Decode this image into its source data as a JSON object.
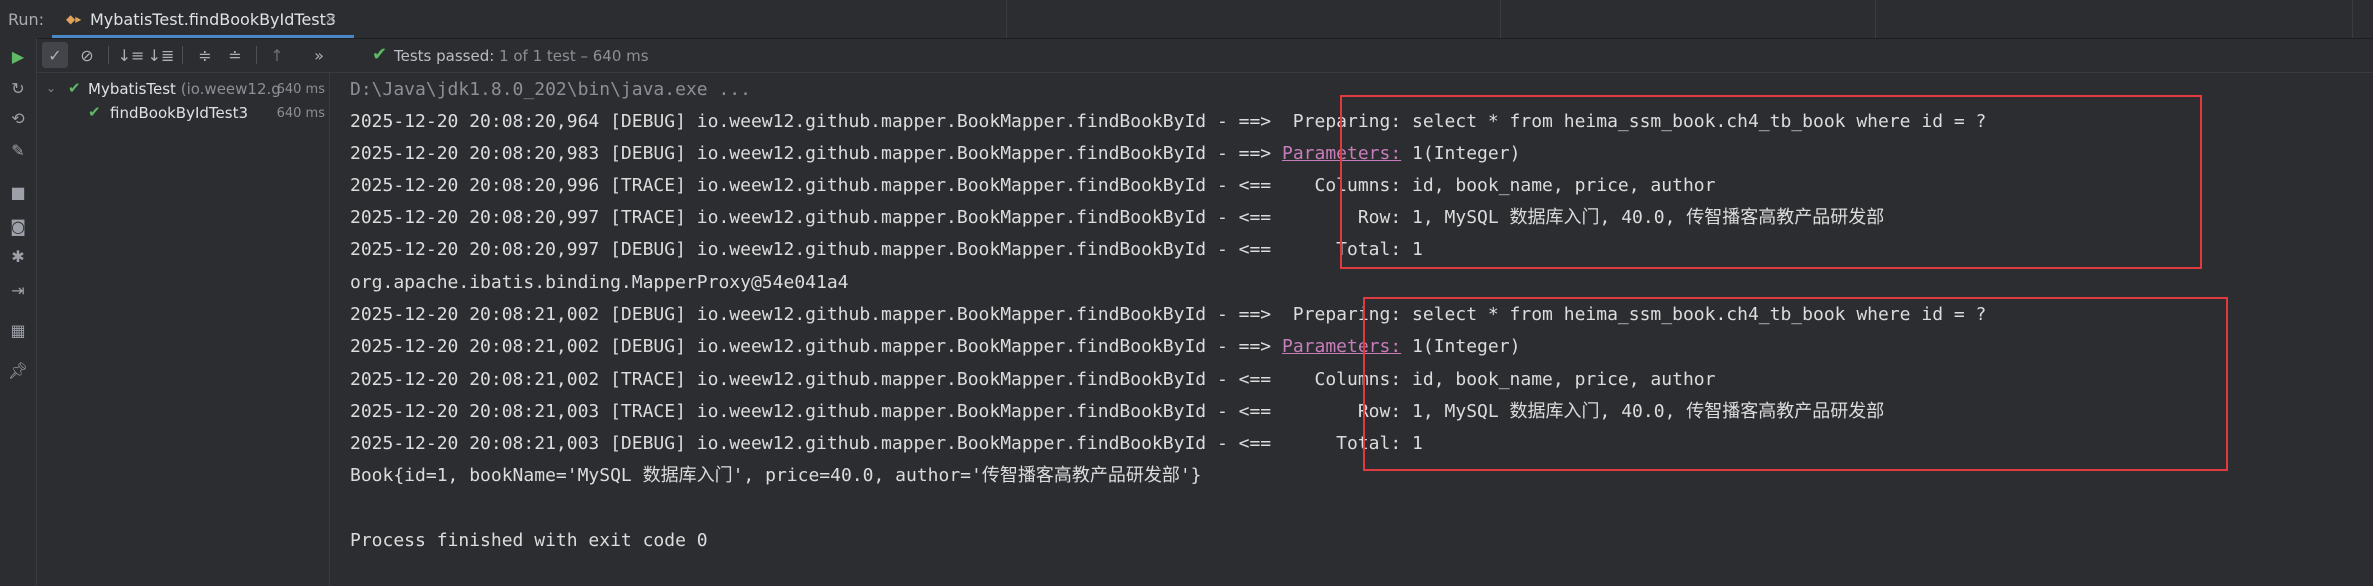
{
  "header": {
    "run_label": "Run:",
    "tab_title": "MybatisTest.findBookByIdTest3",
    "tab_close": "×"
  },
  "toolbar": {
    "status_passed": "Tests passed:",
    "status_count": "1 of 1 test – 640 ms"
  },
  "tree": {
    "root_label": "MybatisTest",
    "root_pkg": "(io.weew12.g",
    "root_time": "640 ms",
    "child_label": "findBookByIdTest3",
    "child_time": "640 ms"
  },
  "console": {
    "cmd": "D:\\Java\\jdk1.8.0_202\\bin\\java.exe ...",
    "lines": [
      {
        "prefix": "2025-12-20 20:08:20,964 [DEBUG] io.weew12.github.mapper.BookMapper.findBookById - ==>  Preparing: select * from heima_ssm_book.ch4_tb_book where id = ?"
      },
      {
        "prefix": "2025-12-20 20:08:20,983 [DEBUG] io.weew12.github.mapper.BookMapper.findBookById - ==> ",
        "link": "Parameters:",
        "suffix": " 1(Integer)"
      },
      {
        "prefix": "2025-12-20 20:08:20,996 [TRACE] io.weew12.github.mapper.BookMapper.findBookById - <==    Columns: id, book_name, price, author"
      },
      {
        "prefix": "2025-12-20 20:08:20,997 [TRACE] io.weew12.github.mapper.BookMapper.findBookById - <==        Row: 1, MySQL 数据库入门, 40.0, 传智播客高教产品研发部"
      },
      {
        "prefix": "2025-12-20 20:08:20,997 [DEBUG] io.weew12.github.mapper.BookMapper.findBookById - <==      Total: 1"
      },
      {
        "prefix": "org.apache.ibatis.binding.MapperProxy@54e041a4"
      },
      {
        "prefix": "2025-12-20 20:08:21,002 [DEBUG] io.weew12.github.mapper.BookMapper.findBookById - ==>  Preparing: select * from heima_ssm_book.ch4_tb_book where id = ?"
      },
      {
        "prefix": "2025-12-20 20:08:21,002 [DEBUG] io.weew12.github.mapper.BookMapper.findBookById - ==> ",
        "link": "Parameters:",
        "suffix": " 1(Integer)"
      },
      {
        "prefix": "2025-12-20 20:08:21,002 [TRACE] io.weew12.github.mapper.BookMapper.findBookById - <==    Columns: id, book_name, price, author"
      },
      {
        "prefix": "2025-12-20 20:08:21,003 [TRACE] io.weew12.github.mapper.BookMapper.findBookById - <==        Row: 1, MySQL 数据库入门, 40.0, 传智播客高教产品研发部"
      },
      {
        "prefix": "2025-12-20 20:08:21,003 [DEBUG] io.weew12.github.mapper.BookMapper.findBookById - <==      Total: 1"
      },
      {
        "prefix": "Book{id=1, bookName='MySQL 数据库入门', price=40.0, author='传智播客高教产品研发部'}"
      },
      {
        "prefix": ""
      },
      {
        "prefix": "Process finished with exit code 0"
      }
    ]
  },
  "colors": {
    "highlight_box": "#e0393e",
    "pass_green": "#5fb865",
    "parameters_link": "#c77dbb"
  },
  "icons": {
    "left_toolbar": [
      "run-icon",
      "rerun-failed-icon",
      "toggle-auto-test-icon",
      "wrench-icon",
      "stop-icon",
      "camera-icon",
      "debug-icon",
      "exit-icon",
      "layout-icon",
      "pin-icon"
    ],
    "test_toolbar": [
      "show-passed-icon",
      "show-ignored-icon",
      "sort-alpha-icon",
      "sort-duration-icon",
      "expand-all-icon",
      "collapse-all-icon",
      "prev-failed-icon",
      "more-icon"
    ]
  }
}
